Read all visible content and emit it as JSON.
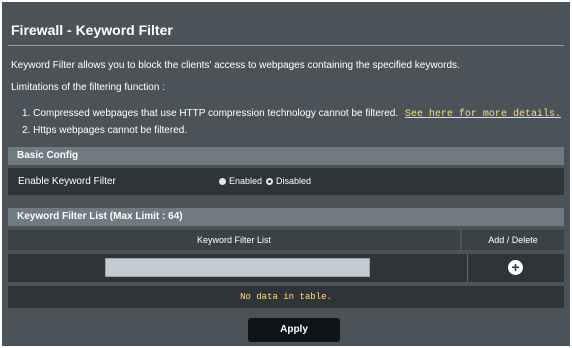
{
  "page": {
    "title": "Firewall - Keyword Filter",
    "description": "Keyword Filter allows you to block the clients' access to webpages containing the specified keywords.",
    "limitations_heading": "Limitations of the filtering function :",
    "limitation_1": "1. Compressed webpages that use HTTP compression technology cannot be filtered.",
    "limitation_1_link": "See here for more details.",
    "limitation_2": "2. Https webpages cannot be filtered."
  },
  "basic_config": {
    "header": "Basic Config",
    "enable_label": "Enable Keyword Filter",
    "options": [
      "Enabled",
      "Disabled"
    ],
    "selected": "Enabled"
  },
  "keyword_list": {
    "header": "Keyword Filter List (Max Limit : 64)",
    "col_list": "Keyword Filter List",
    "col_action": "Add / Delete",
    "input_value": "",
    "empty_text": "No data in table."
  },
  "actions": {
    "apply_label": "Apply"
  },
  "colors": {
    "background": "#4c5358",
    "row": "#2e3438",
    "accent": "#fddc85"
  }
}
